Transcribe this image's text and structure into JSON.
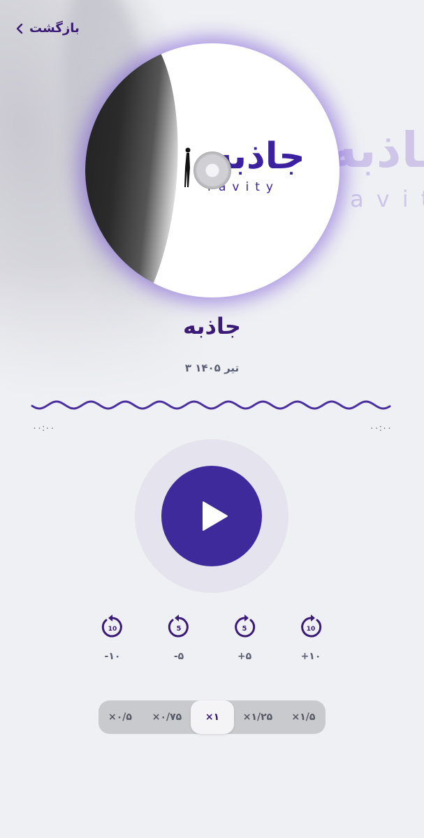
{
  "header": {
    "back_label": "بازگشت"
  },
  "episode": {
    "title": "جاذبه",
    "date": "۳ تیر ۱۴۰۵",
    "cover": {
      "logo_text": "جاذبه",
      "logo_subtext": "ravity"
    }
  },
  "player": {
    "time_elapsed": "۰۰:۰۰",
    "time_total": "۰۰:۰۰",
    "is_playing": false,
    "skip": [
      {
        "id": "back10",
        "label": "-۱۰",
        "seconds": 10,
        "direction": "back"
      },
      {
        "id": "back5",
        "label": "-۵",
        "seconds": 5,
        "direction": "back"
      },
      {
        "id": "fwd5",
        "label": "+۵",
        "seconds": 5,
        "direction": "forward"
      },
      {
        "id": "fwd10",
        "label": "+۱۰",
        "seconds": 10,
        "direction": "forward"
      }
    ],
    "speeds": [
      "×۰/۵",
      "×۰/۷۵",
      "×۱",
      "×۱/۲۵",
      "×۱/۵"
    ],
    "selected_speed": "×۱"
  },
  "colors": {
    "accent": "#3f2a9b",
    "text_primary": "#3b1b76",
    "background": "#eff0f4"
  },
  "icons": {
    "back": "chevron-left-icon",
    "play": "play-icon",
    "skip_back": "rotate-ccw-icon",
    "skip_forward": "rotate-cw-icon"
  }
}
